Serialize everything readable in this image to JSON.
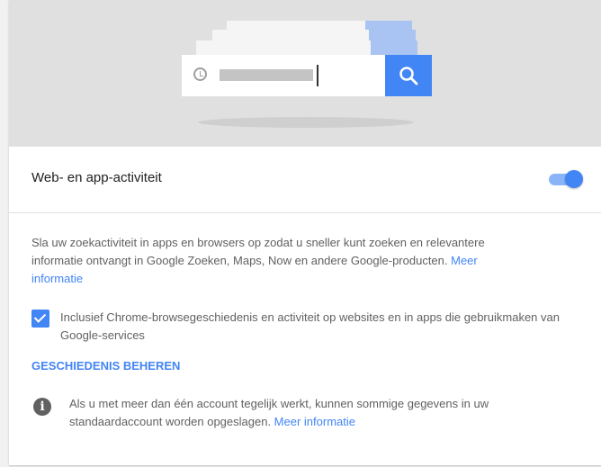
{
  "setting": {
    "title": "Web- en app-activiteit",
    "enabled": true
  },
  "description": {
    "text": "Sla uw zoekactiviteit in apps en browsers op zodat u sneller kunt zoeken en relevantere informatie ontvangt in Google Zoeken, Maps, Now en andere Google-producten. ",
    "link": "Meer informatie"
  },
  "checkbox": {
    "label": "Inclusief Chrome-browsegeschiedenis en activiteit op websites en in apps die gebruikmaken van Google-services",
    "checked": true
  },
  "manage_button": "GESCHIEDENIS BEHEREN",
  "info": {
    "text": "Als u met meer dan één account tegelijk werkt, kunnen sommige gegevens in uw standaardaccount worden opgeslagen. ",
    "link": "Meer informatie"
  },
  "colors": {
    "accent": "#4285f4",
    "hero_bg": "#e0e0e0"
  }
}
